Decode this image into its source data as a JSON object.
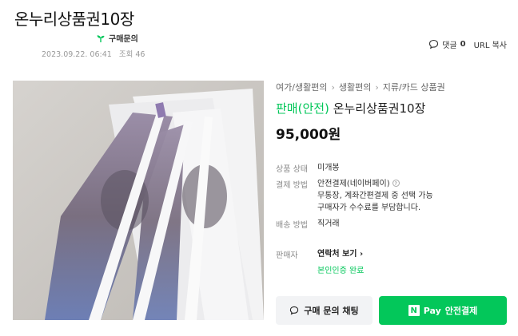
{
  "article": {
    "title": "온누리상품권10장",
    "author_badge": "구매문의",
    "date": "2023.09.22. 06:41",
    "views": "조회 46"
  },
  "actions": {
    "comment_label": "댓글",
    "comment_count": "0",
    "url_copy": "URL 복사"
  },
  "product": {
    "breadcrumb": [
      "여가/생활편의",
      "생활편의",
      "지류/카드 상품권"
    ],
    "status": "판매(안전)",
    "name": "온누리상품권10장",
    "price": "95,000원"
  },
  "details": {
    "condition_label": "상품 상태",
    "condition_value": "미개봉",
    "payment_label": "결제 방법",
    "payment_value_1": "안전결제(네이버페이)",
    "payment_help": "?",
    "payment_value_2": "무통장, 계좌간편결제 중 선택 가능",
    "payment_value_3": "구매자가 수수료를 부담합니다.",
    "delivery_label": "배송 방법",
    "delivery_value": "직거래",
    "seller_label": "판매자",
    "seller_contact": "연락처 보기",
    "seller_verified": "본인인증 완료"
  },
  "buttons": {
    "chat": "구매 문의 채팅",
    "pay_logo": "N",
    "pay_brand": "Pay",
    "pay_label": "안전결제"
  },
  "colors": {
    "accent": "#03c75a"
  }
}
